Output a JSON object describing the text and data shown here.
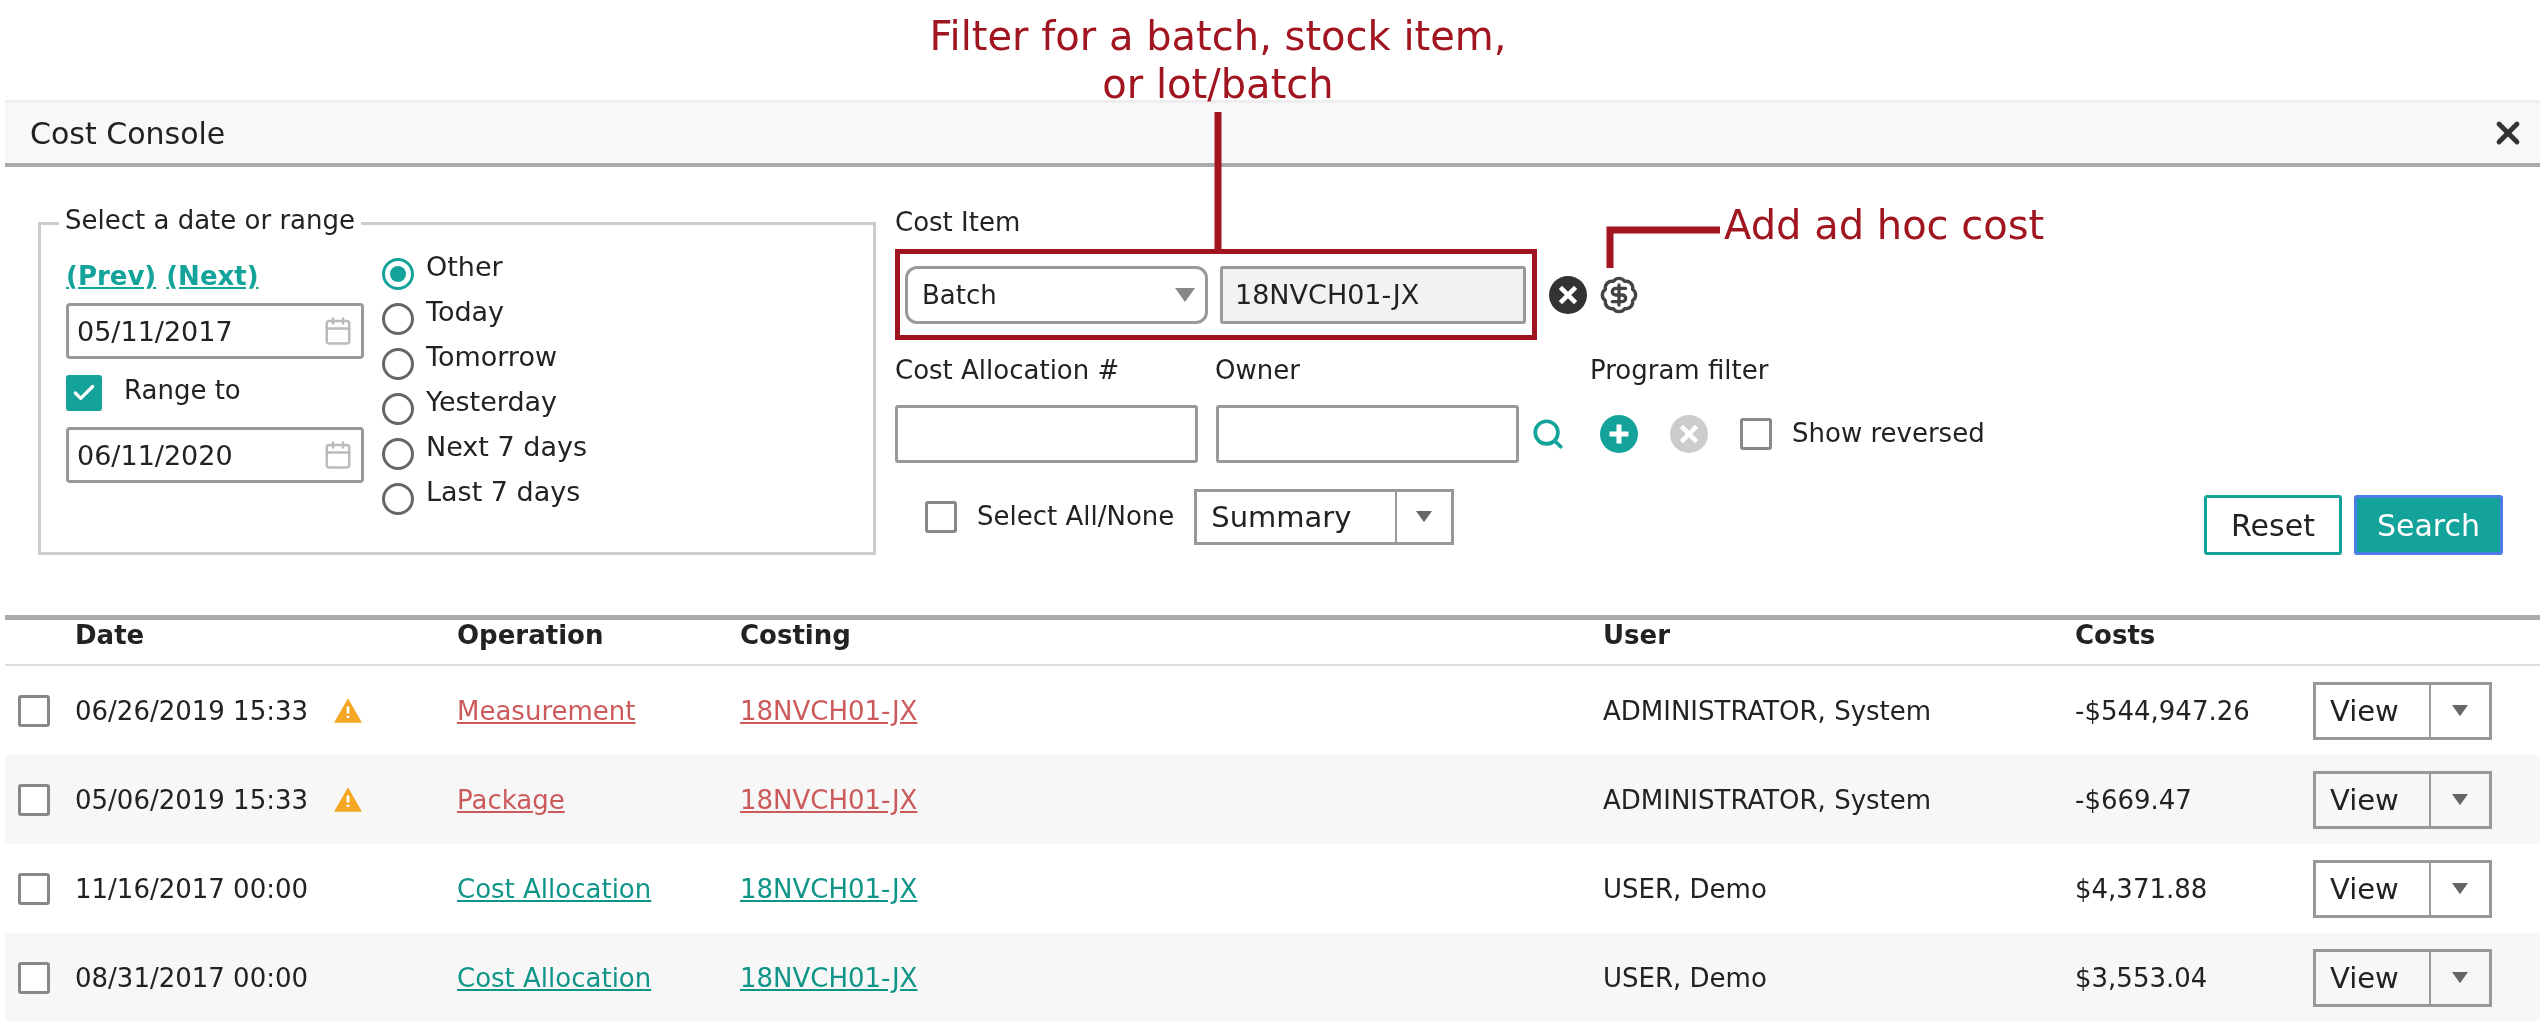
{
  "annotations": [
    {
      "text": "Filter for a batch, stock item, or lot/batch"
    },
    {
      "text": "Add ad hoc cost"
    }
  ],
  "window": {
    "title": "Cost Console"
  },
  "date_range": {
    "legend": "Select a date or range",
    "prev": "(Prev)",
    "next": "(Next)",
    "from": "05/11/2017",
    "range_to": {
      "label": "Range to",
      "checked": true
    },
    "to": "06/11/2020",
    "options": [
      {
        "label": "Other",
        "selected": true
      },
      {
        "label": "Today",
        "selected": false
      },
      {
        "label": "Tomorrow",
        "selected": false
      },
      {
        "label": "Yesterday",
        "selected": false
      },
      {
        "label": "Next 7 days",
        "selected": false
      },
      {
        "label": "Last 7 days",
        "selected": false
      }
    ]
  },
  "cost_item": {
    "label": "Cost Item",
    "type": "Batch",
    "value": "18NVCH01-JX"
  },
  "cost_allocation": {
    "label": "Cost Allocation #"
  },
  "owner": {
    "label": "Owner"
  },
  "program_filter": {
    "label": "Program filter"
  },
  "show_reversed": {
    "label": "Show reversed",
    "checked": false
  },
  "select_all": {
    "label": "Select All/None",
    "checked": false
  },
  "view_mode": {
    "value": "Summary"
  },
  "buttons": [
    {
      "label": "Reset",
      "kind": "secondary"
    },
    {
      "label": "Search",
      "kind": "primary"
    }
  ],
  "table": {
    "columns": [
      "Date",
      "Operation",
      "Costing",
      "User",
      "Costs"
    ],
    "rows": [
      {
        "checked": false,
        "date": "06/26/2019 15:33",
        "warning": true,
        "operation": "Measurement",
        "costing": "18NVCH01-JX",
        "user": "ADMINISTRATOR, System",
        "cost": "-$544,947.26",
        "action": "View"
      },
      {
        "checked": false,
        "date": "05/06/2019 15:33",
        "warning": true,
        "operation": "Package",
        "costing": "18NVCH01-JX",
        "user": "ADMINISTRATOR, System",
        "cost": "-$669.47",
        "action": "View"
      },
      {
        "checked": false,
        "date": "11/16/2017 00:00",
        "warning": false,
        "operation": "Cost Allocation",
        "costing": "18NVCH01-JX",
        "user": "USER, Demo",
        "cost": "$4,371.88",
        "action": "View"
      },
      {
        "checked": false,
        "date": "08/31/2017 00:00",
        "warning": false,
        "operation": "Cost Allocation",
        "costing": "18NVCH01-JX",
        "user": "USER, Demo",
        "cost": "$3,553.04",
        "action": "View"
      }
    ]
  }
}
